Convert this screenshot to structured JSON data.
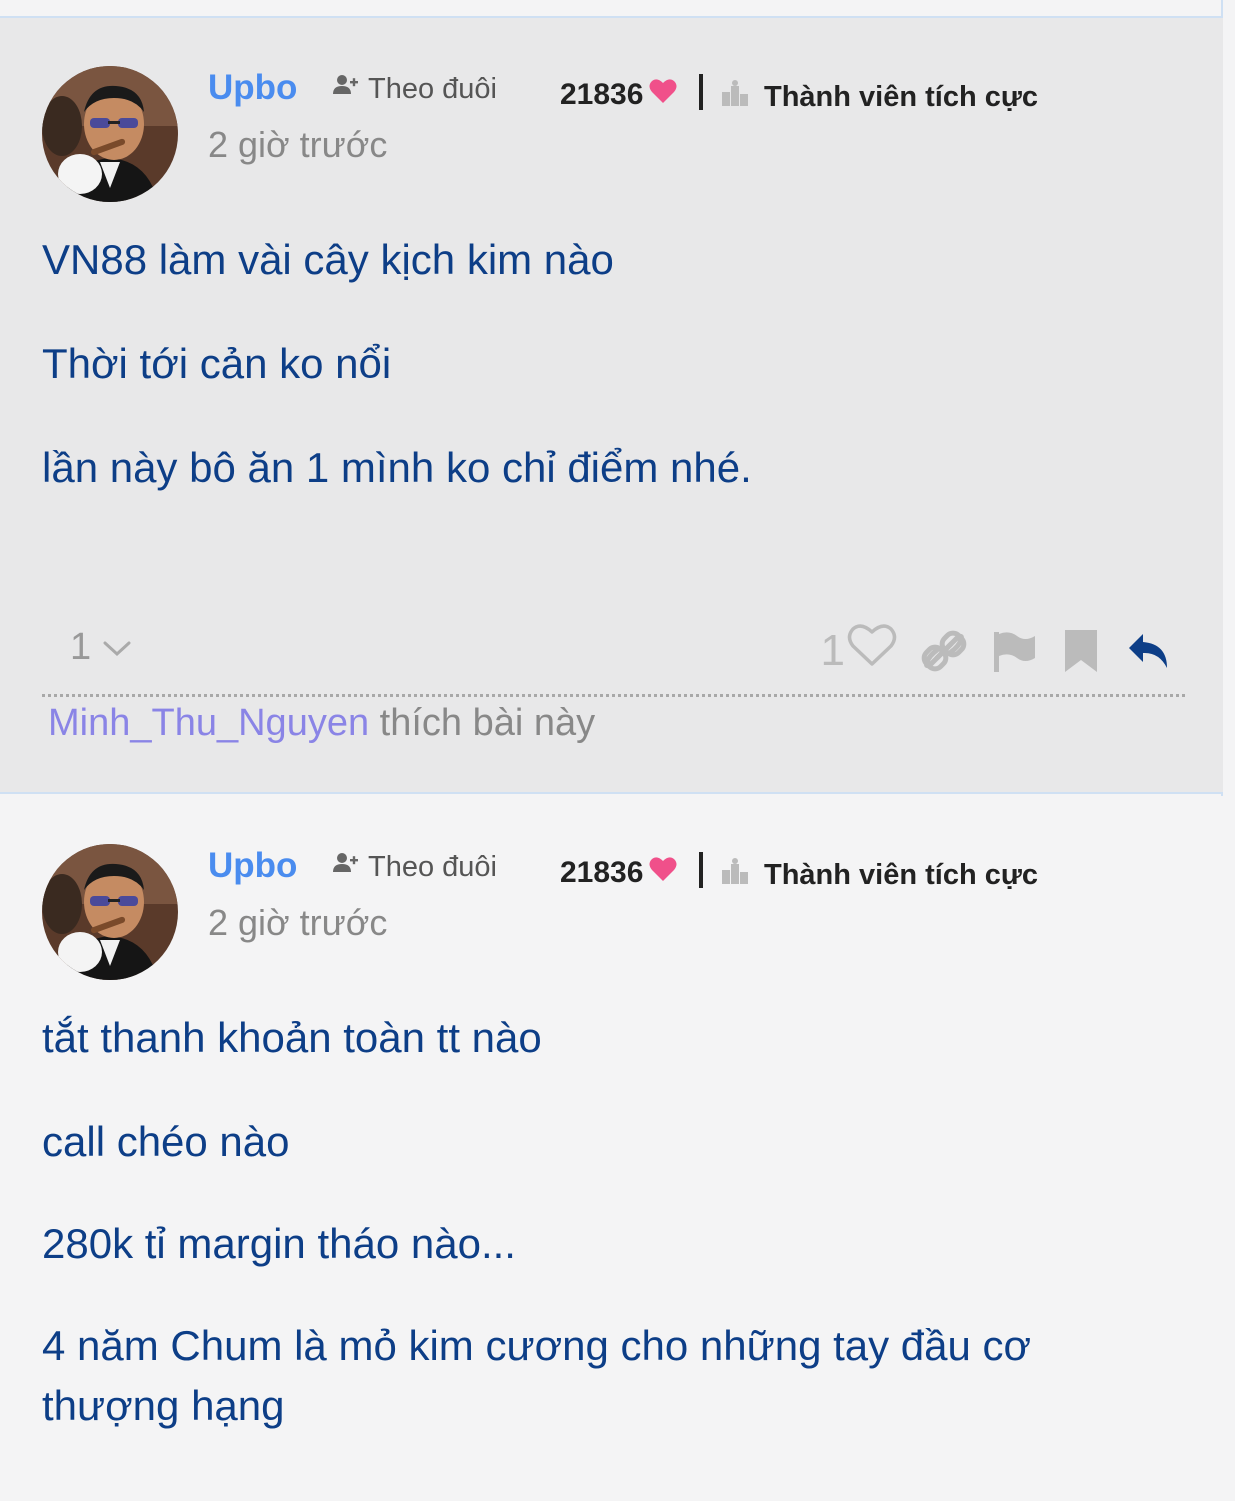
{
  "posts": [
    {
      "username": "Upbo",
      "follow_label": "Theo đuôi",
      "points": "21836",
      "rank": "Thành viên tích cực",
      "timestamp": "2 giờ trước",
      "lines": [
        "VN88 làm vài cây kịch kim nào",
        "Thời tới cản ko nổi",
        "lần này bô ăn 1 mình ko chỉ điểm nhé."
      ],
      "reaction_count": "1",
      "like_count": "1",
      "liked_by_user": "Minh_Thu_Nguyen",
      "liked_by_suffix": " thích bài này"
    },
    {
      "username": "Upbo",
      "follow_label": "Theo đuôi",
      "points": "21836",
      "rank": "Thành viên tích cực",
      "timestamp": "2 giờ trước",
      "lines": [
        "tắt thanh khoản toàn tt nào",
        "call chéo nào",
        "280k tỉ margin tháo nào...",
        "4 năm Chum là mỏ kim cương cho những tay đầu cơ",
        "thượng hạng"
      ]
    }
  ],
  "icons": {
    "follow": "user-plus-icon",
    "points": "heart-icon",
    "rank": "rank-badge-icon",
    "reaction_toggle": "chevron-down-icon",
    "like": "heart-outline-icon",
    "link": "link-icon",
    "report": "flag-icon",
    "bookmark": "bookmark-icon",
    "reply": "reply-icon"
  },
  "colors": {
    "username": "#4a8cef",
    "body_text": "#0d3e87",
    "heart": "#f0508a",
    "liker": "#8a84e6",
    "highlight_bg": "#e8e8e9",
    "reply_icon": "#0d3e87"
  }
}
